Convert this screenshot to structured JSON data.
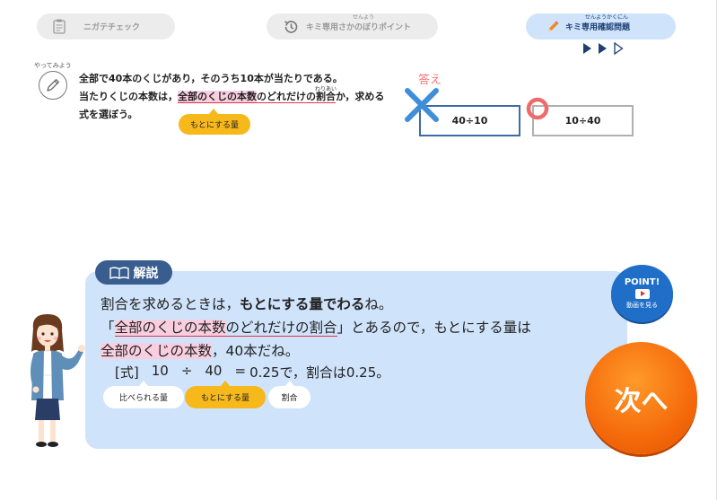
{
  "steps": [
    {
      "label": "ニガテチェック",
      "ruby": "",
      "icon": "clipboard-icon",
      "state": "inactive"
    },
    {
      "label": "キミ専用さかのぼりポイント",
      "ruby": "せんよう",
      "icon": "history-icon",
      "state": "inactive"
    },
    {
      "label": "キミ専用確認問題",
      "ruby": "せんようかくにん",
      "icon": "pencil-icon",
      "state": "active"
    }
  ],
  "question": {
    "try_ruby": "やってみよう",
    "line1": "全部で40本のくじがあり，そのうち10本が当たりである。",
    "line2_pre": "当たりくじの本数は，",
    "line2_base": "全部のくじの本数",
    "line2_mid": "のどれだけの",
    "line2_ratio": "割合",
    "line2_ratio_ruby": "わりあい",
    "line2_post": "か，求める",
    "line3": "式を選ぼう。",
    "tag_base": "もとにする量"
  },
  "answer": {
    "label": "答え",
    "choices": [
      "40÷10",
      "10÷40"
    ],
    "colors": {
      "wrong": "#3f8fd8",
      "correct": "#ef6b6b"
    }
  },
  "explanation": {
    "header": "解説",
    "line1_pre": "割合を求めるときは，",
    "line1_bold": "もとにする量でわる",
    "line1_post": "ね。",
    "line2_open": "「",
    "line2_base": "全部のくじの本数",
    "line2_mid": "のどれだけの割合",
    "line2_close": "」とあるので，もとにする量は",
    "line3_base": "全部のくじの本数",
    "line3_post": "，40本だね。",
    "formula": [
      "[式]",
      "10",
      "÷",
      "40",
      "=",
      "0.25で，割合は0.25。"
    ],
    "tags": [
      "比べられる量",
      "もとにする量",
      "割合"
    ]
  },
  "point_button": {
    "title": "POINT!",
    "sub": "動画を見る"
  },
  "next_button": "次へ",
  "colors": {
    "accent_blue": "#cfe3fb",
    "header_blue": "#3a5d8f",
    "orange": "#f56a0b",
    "tag_yellow": "#f6b81a",
    "pink_highlight": "#f9cfe0",
    "red_underline": "#e0344a"
  }
}
